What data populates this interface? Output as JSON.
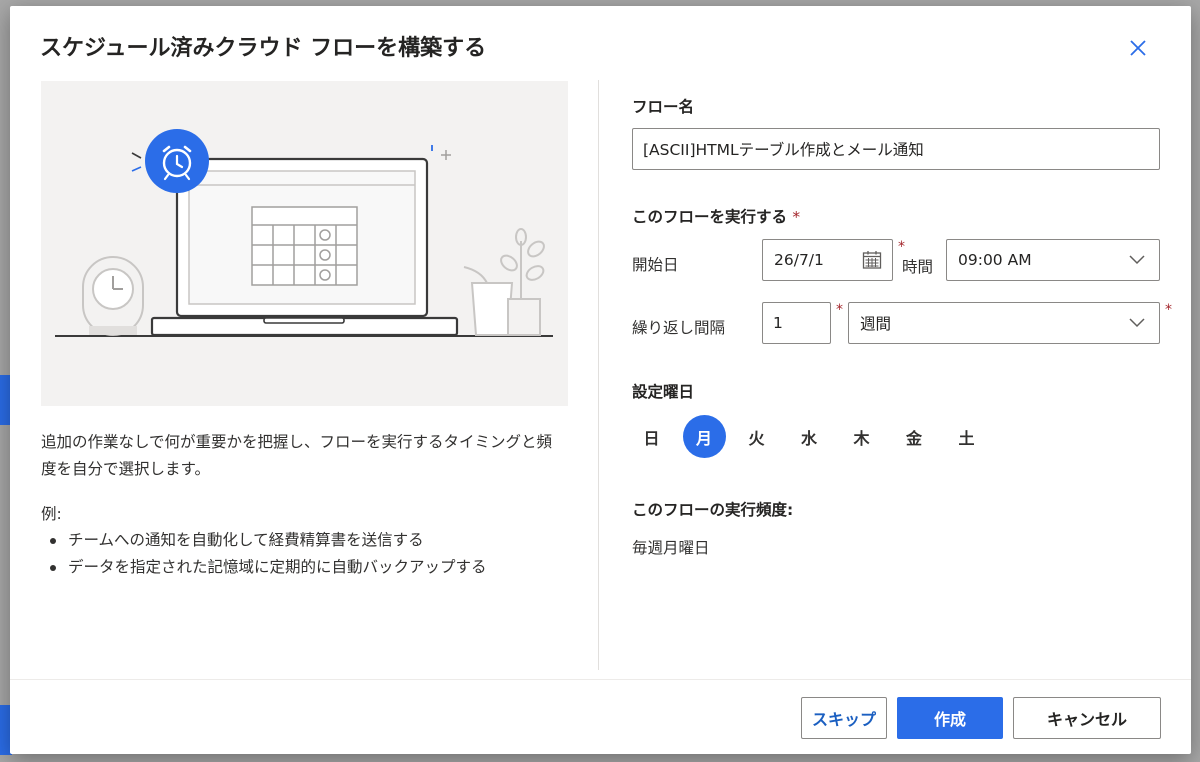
{
  "dialog": {
    "title": "スケジュール済みクラウド フローを構築する",
    "close_icon": "close-icon"
  },
  "left": {
    "illustration_icon": "alarm-clock-icon",
    "description": "追加の作業なしで何が重要かを把握し、フローを実行するタイミングと頻度を自分で選択します。",
    "example_label": "例:",
    "examples": [
      "チームへの通知を自動化して経費精算書を送信する",
      "データを指定された記憶域に定期的に自動バックアップする"
    ]
  },
  "form": {
    "flow_name_label": "フロー名",
    "flow_name_value": "[ASCII]HTMLテーブル作成とメール通知",
    "run_label": "このフローを実行する",
    "required_mark": "*",
    "start_date_label": "開始日",
    "start_date_value": "26/7/1",
    "time_label": "時間",
    "time_value": "09:00 AM",
    "repeat_label": "繰り返し間隔",
    "repeat_count": "1",
    "repeat_unit": "週間",
    "weekday_label": "設定曜日",
    "weekdays": [
      "日",
      "月",
      "火",
      "水",
      "木",
      "金",
      "土"
    ],
    "selected_weekday": "月",
    "frequency_label": "このフローの実行頻度:",
    "frequency_value": "毎週月曜日"
  },
  "footer": {
    "skip_label": "スキップ",
    "create_label": "作成",
    "cancel_label": "キャンセル"
  },
  "colors": {
    "accent": "#2b6de8",
    "required": "#a4262c",
    "illustration_bg": "#f3f2f1"
  }
}
